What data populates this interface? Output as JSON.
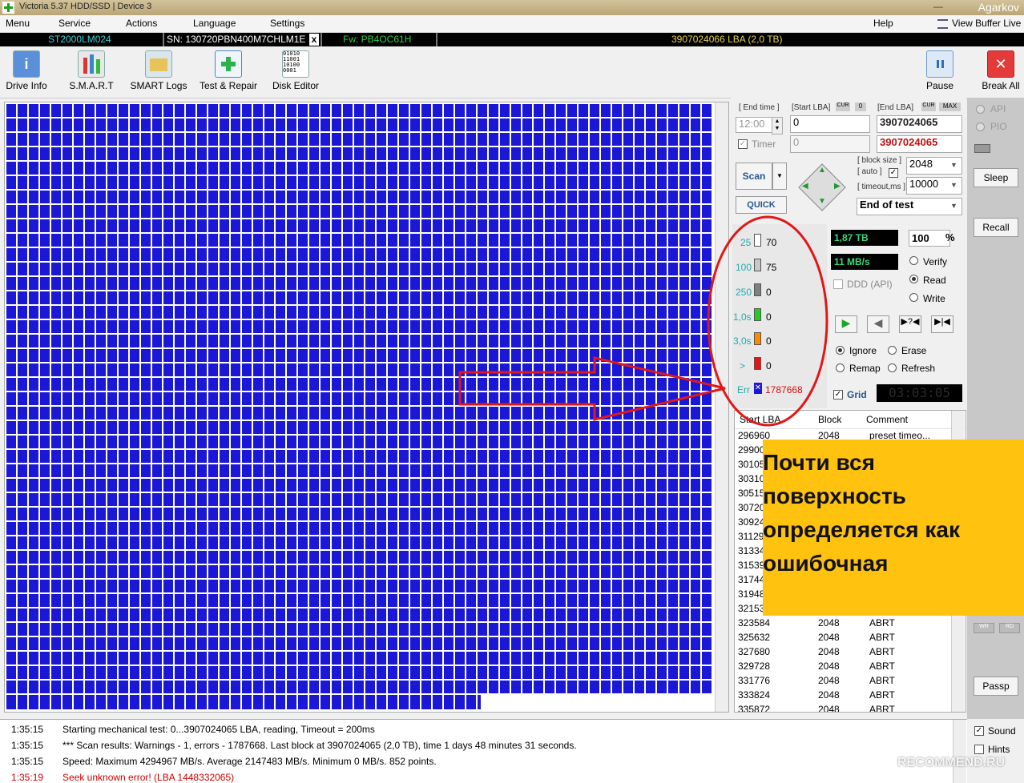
{
  "window": {
    "title": "Victoria 5.37 HDD/SSD | Device 3",
    "user": "Agarkov"
  },
  "menu": {
    "items": [
      "Menu",
      "Service",
      "Actions",
      "Language",
      "Settings"
    ],
    "help": "Help",
    "view_buffer": "View Buffer Live"
  },
  "infobar": {
    "model": "ST2000LM024",
    "serial": "SN: 130720PBN400M7CHLM1E",
    "close": "x",
    "firmware": "Fw: PB4OC61H",
    "capacity": "3907024066 LBA (2,0 TB)"
  },
  "toolbar": {
    "items": [
      "Drive Info",
      "S.M.A.R.T",
      "SMART Logs",
      "Test & Repair",
      "Disk Editor"
    ],
    "pause": "Pause",
    "break_all": "Break All"
  },
  "scan": {
    "end_time_label": "[ End time ]",
    "end_time_value": "12:00",
    "timer_label": "Timer",
    "start_lba_label": "[Start LBA]",
    "start_lba_cur": "CUR",
    "start_lba_zero": "0",
    "start_lba_value": "0",
    "start_lba_value2": "0",
    "end_lba_label": "[End LBA]",
    "end_lba_cur": "CUR",
    "end_lba_max": "MAX",
    "end_lba_value": "3907024065",
    "end_lba_value2": "3907024065",
    "scan_button": "Scan",
    "quick_button": "QUICK",
    "block_size_label": "[ block size ]",
    "auto_label": "[ auto ]",
    "block_size_value": "2048",
    "timeout_label": "[ timeout,ms ]",
    "timeout_value": "10000",
    "end_mode": "End of test"
  },
  "legend": [
    {
      "num": "25",
      "val": "70",
      "color": "#ffffff"
    },
    {
      "num": "100",
      "val": "75",
      "color": "#c8c8c8"
    },
    {
      "num": "250",
      "val": "0",
      "color": "#808080"
    },
    {
      "num": "1,0s",
      "val": "0",
      "color": "#22cc22"
    },
    {
      "num": "3,0s",
      "val": "0",
      "color": "#ff8800"
    },
    {
      "num": ">",
      "val": "0",
      "color": "#ee1111"
    }
  ],
  "errors": {
    "label": "Err",
    "value": "1787668"
  },
  "stats": {
    "done": "1,87 TB",
    "percent": "100",
    "percent_sign": "%",
    "speed": "11 MB/s",
    "ddd": "DDD (API)"
  },
  "modes": {
    "verify": "Verify",
    "read": "Read",
    "write": "Write"
  },
  "actions": {
    "ignore": "Ignore",
    "erase": "Erase",
    "remap": "Remap",
    "refresh": "Refresh"
  },
  "grid": {
    "label": "Grid",
    "timer": "03:03:05"
  },
  "table": {
    "headers": [
      "Start LBA",
      "Block",
      "Comment"
    ],
    "rows": [
      [
        "296960",
        "2048",
        "preset timeo..."
      ],
      [
        "29900",
        "",
        ""
      ],
      [
        "30105",
        "",
        ""
      ],
      [
        "30310",
        "",
        ""
      ],
      [
        "30515",
        "",
        ""
      ],
      [
        "30720",
        "",
        ""
      ],
      [
        "30924",
        "",
        ""
      ],
      [
        "31129",
        "",
        ""
      ],
      [
        "31334",
        "",
        ""
      ],
      [
        "31539",
        "",
        ""
      ],
      [
        "31744",
        "",
        ""
      ],
      [
        "31948",
        "",
        ""
      ],
      [
        "32153",
        "",
        ""
      ],
      [
        "323584",
        "2048",
        "ABRT"
      ],
      [
        "325632",
        "2048",
        "ABRT"
      ],
      [
        "327680",
        "2048",
        "ABRT"
      ],
      [
        "329728",
        "2048",
        "ABRT"
      ],
      [
        "331776",
        "2048",
        "ABRT"
      ],
      [
        "333824",
        "2048",
        "ABRT"
      ],
      [
        "335872",
        "2048",
        "ABRT"
      ]
    ]
  },
  "side": {
    "api": "API",
    "pio": "PIO",
    "sleep": "Sleep",
    "recall": "Recall",
    "wr": "WR",
    "rd": "RD",
    "passp": "Passp",
    "sound": "Sound",
    "hints": "Hints"
  },
  "log": [
    {
      "time": "1:35:15",
      "msg": "Starting mechanical test: 0...3907024065 LBA, reading, Timeout = 200ms",
      "color": "#000000"
    },
    {
      "time": "1:35:15",
      "msg": "*** Scan results: Warnings - 1, errors - 1787668. Last block at 3907024065 (2,0 TB), time 1 days 48 minutes 31 seconds.",
      "color": "#000000"
    },
    {
      "time": "1:35:15",
      "msg": "Speed: Maximum 4294967 MB/s. Average 2147483 MB/s. Minimum 0 MB/s. 852 points.",
      "color": "#000000"
    },
    {
      "time": "1:35:19",
      "msg": "Seek unknown error! (LBA 1448332065)",
      "color": "#d00000"
    }
  ],
  "annotation": {
    "text": "Почти вся\nповерхность\nопределяется как\nошибочная"
  },
  "watermark": "RECOMMEND.RU"
}
